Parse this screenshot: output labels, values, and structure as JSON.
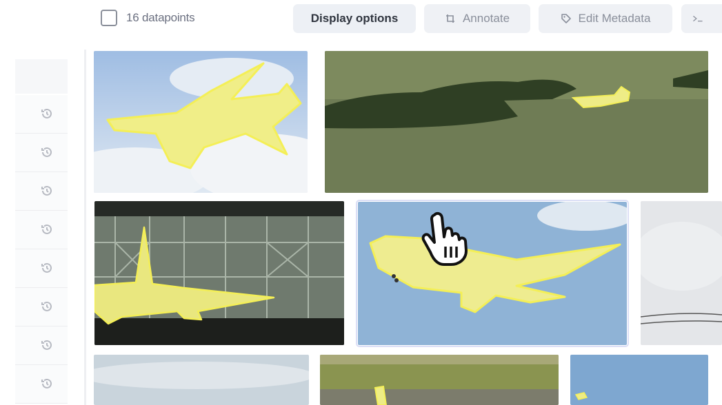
{
  "toolbar": {
    "datapoints_label": "16 datapoints",
    "display_options_label": "Display options",
    "annotate_label": "Annotate",
    "edit_metadata_label": "Edit Metadata",
    "more_label": ">_",
    "icons": [
      "crop-icon",
      "tag-icon",
      "terminal-icon"
    ]
  },
  "sidebar": {
    "rows": [
      {
        "icon": "history-icon"
      },
      {
        "icon": "history-icon"
      },
      {
        "icon": "history-icon"
      },
      {
        "icon": "history-icon"
      },
      {
        "icon": "history-icon"
      },
      {
        "icon": "history-icon"
      },
      {
        "icon": "history-icon"
      },
      {
        "icon": "history-icon"
      }
    ]
  },
  "grid": {
    "tiles": [
      {
        "name": "airliner-over-clouds"
      },
      {
        "name": "plane-over-water-islands"
      },
      {
        "name": "plane-in-hangar"
      },
      {
        "name": "airliner-blue-sky",
        "selected": true
      },
      {
        "name": "sky-power-lines"
      },
      {
        "name": "sky-horizon"
      },
      {
        "name": "runway-grass"
      },
      {
        "name": "blue-sky-small-plane"
      }
    ],
    "highlight_color": "#f2f08a",
    "highlight_outline": "#f4ef56"
  },
  "colors": {
    "toolbar_button_bg": "#eff1f5",
    "selection_outline": "#dcdff6"
  }
}
